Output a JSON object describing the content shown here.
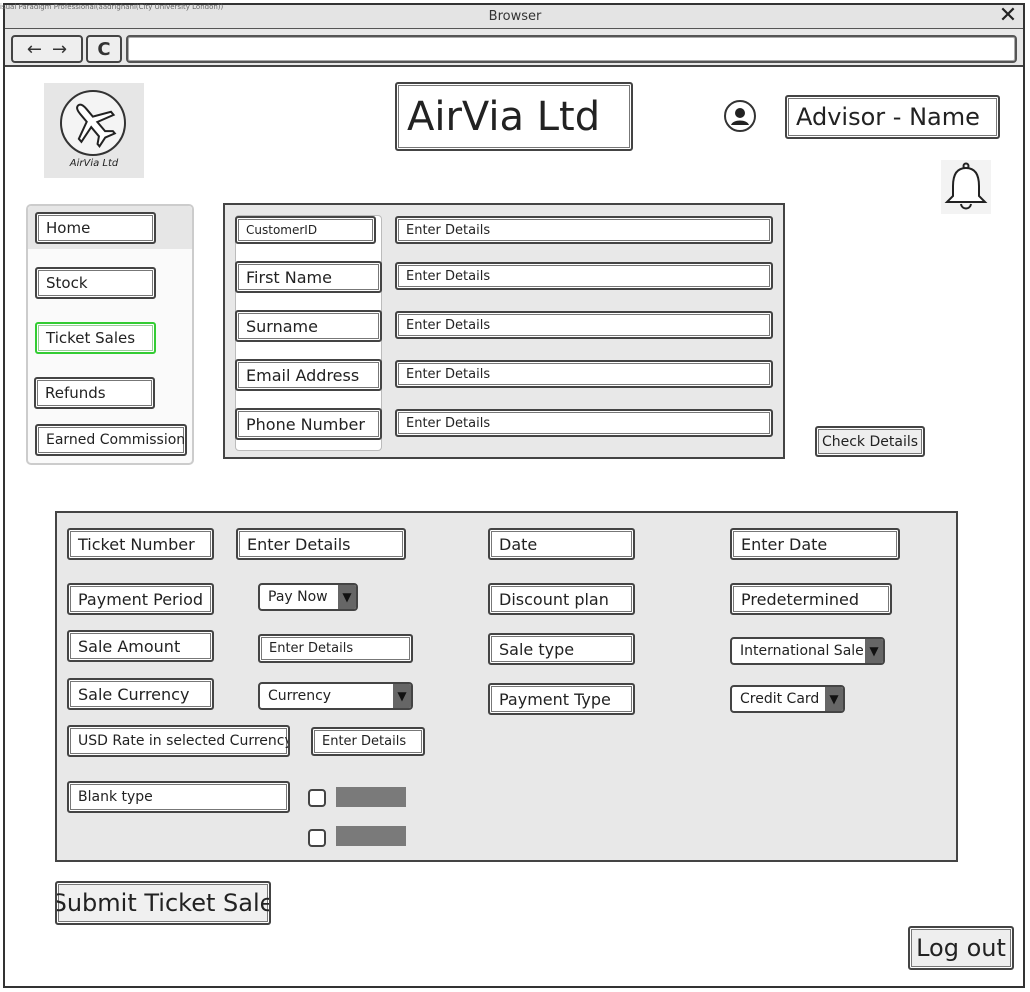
{
  "browser": {
    "watermark": "isual Paradigm Professional(aadrighani(City University London))",
    "title": "Browser",
    "close_glyph": "✕",
    "back_glyph": "←",
    "forward_glyph": "→",
    "refresh_glyph": "C",
    "url": ""
  },
  "header": {
    "logo_text": "AirVia Ltd",
    "company_title": "AirVia Ltd",
    "advisor_name": "Advisor - Name",
    "icons": {
      "user": "user-icon",
      "notifications": "bell-icon",
      "logo": "airplane-icon"
    }
  },
  "sidebar": {
    "items": [
      {
        "label": "Home",
        "active": false
      },
      {
        "label": "Stock",
        "active": false
      },
      {
        "label": "Ticket Sales",
        "active": true
      },
      {
        "label": "Refunds",
        "active": false
      },
      {
        "label": "Earned Commission",
        "active": false
      }
    ],
    "active_color": "#33cc33"
  },
  "customer": {
    "fields": [
      {
        "label": "CustomerID",
        "placeholder": "Enter Details"
      },
      {
        "label": "First Name",
        "placeholder": "Enter Details"
      },
      {
        "label": "Surname",
        "placeholder": "Enter Details"
      },
      {
        "label": "Email Address",
        "placeholder": "Enter Details"
      },
      {
        "label": "Phone Number",
        "placeholder": "Enter Details"
      }
    ],
    "check_button": "Check Details"
  },
  "ticket": {
    "ticket_number_label": "Ticket Number",
    "ticket_number_value": "Enter Details",
    "date_label": "Date",
    "date_value": "Enter Date",
    "payment_period_label": "Payment Period",
    "payment_period_value": "Pay Now",
    "discount_plan_label": "Discount plan",
    "discount_plan_value": "Predetermined",
    "sale_amount_label": "Sale Amount",
    "sale_amount_value": "Enter Details",
    "sale_type_label": "Sale type",
    "sale_type_value": "International Sale",
    "sale_currency_label": "Sale Currency",
    "sale_currency_value": "Currency",
    "payment_type_label": "Payment Type",
    "payment_type_value": "Credit Card",
    "usd_rate_label": "USD Rate in selected Currency",
    "usd_rate_value": "Enter Details",
    "blank_type_label": "Blank type"
  },
  "actions": {
    "submit": "Submit Ticket Sale",
    "logout": "Log out"
  }
}
